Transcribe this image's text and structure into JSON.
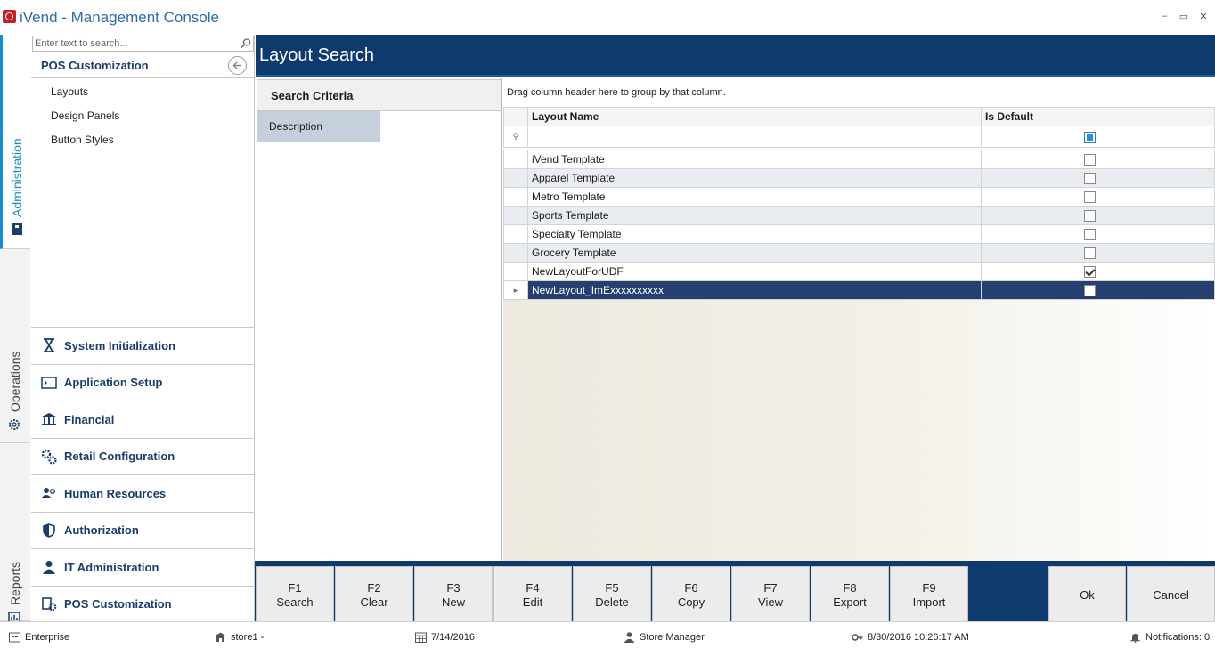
{
  "window": {
    "title": "iVend - Management Console",
    "controls": [
      "–",
      "▭",
      "✕"
    ]
  },
  "vertical_tabs": {
    "administration": "Administration",
    "operations": "Operations",
    "reports": "Reports"
  },
  "left_panel": {
    "search_placeholder": "Enter text to search...",
    "section_title": "POS Customization",
    "sub_items": [
      "Layouts",
      "Design Panels",
      "Button Styles"
    ],
    "modules": [
      "System Initialization",
      "Application Setup",
      "Financial",
      "Retail Configuration",
      "Human Resources",
      "Authorization",
      "IT Administration",
      "POS Customization"
    ]
  },
  "main": {
    "title": "Layout Search",
    "criteria": {
      "header": "Search Criteria",
      "description_label": "Description",
      "description_value": ""
    },
    "grid": {
      "group_hint": "Drag column header here to group by that column.",
      "columns": [
        "Layout Name",
        "Is Default"
      ],
      "rows": [
        {
          "name": "iVend Template",
          "is_default": false
        },
        {
          "name": "Apparel Template",
          "is_default": false
        },
        {
          "name": "Metro Template",
          "is_default": false
        },
        {
          "name": "Sports Template",
          "is_default": false
        },
        {
          "name": "Specialty Template",
          "is_default": false
        },
        {
          "name": "Grocery Template",
          "is_default": false
        },
        {
          "name": "NewLayoutForUDF",
          "is_default": true
        },
        {
          "name": "NewLayout_ImExxxxxxxxxx",
          "is_default": false
        }
      ]
    }
  },
  "function_keys": [
    {
      "key": "F1",
      "label": "Search"
    },
    {
      "key": "F2",
      "label": "Clear"
    },
    {
      "key": "F3",
      "label": "New"
    },
    {
      "key": "F4",
      "label": "Edit"
    },
    {
      "key": "F5",
      "label": "Delete"
    },
    {
      "key": "F6",
      "label": "Copy"
    },
    {
      "key": "F7",
      "label": "View"
    },
    {
      "key": "F8",
      "label": "Export"
    },
    {
      "key": "F9",
      "label": "Import"
    }
  ],
  "action_buttons": {
    "ok": "Ok",
    "cancel": "Cancel"
  },
  "status": {
    "edition": "Enterprise",
    "store": "store1 -",
    "business_date": "7/14/2016",
    "user": "Store Manager",
    "datetime": "8/30/2016 10:26:17 AM",
    "notifications": "Notifications: 0"
  },
  "colors": {
    "header_bg": "#0e3a6e",
    "accent": "#1a8ccc",
    "selected_row": "#253f70"
  }
}
